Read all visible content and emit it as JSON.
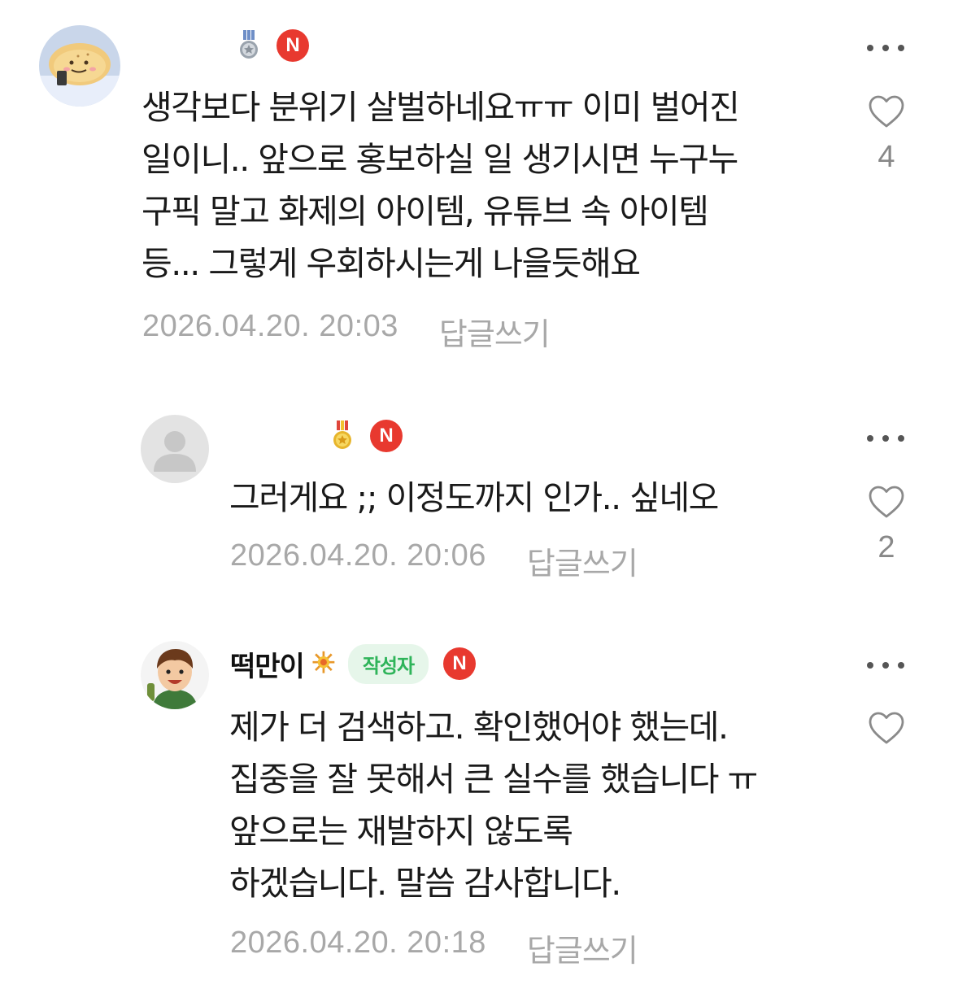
{
  "comments": [
    {
      "author": "",
      "badge": "N",
      "text": "생각보다 분위기 살벌하네요ㅠㅠ 이미 벌어진\n일이니.. 앞으로 홍보하실 일 생기시면 누구누\n구픽 말고 화제의 아이템, 유튜브 속 아이템\n등... 그렇게 우회하시는게 나을듯해요",
      "date": "2026.04.20. 20:03",
      "reply_label": "답글쓰기",
      "likes": "4"
    },
    {
      "author": "",
      "badge": "N",
      "text": "그러게요 ;; 이정도까지 인가.. 싶네오",
      "date": "2026.04.20. 20:06",
      "reply_label": "답글쓰기",
      "likes": "2"
    },
    {
      "author": "떡만이",
      "writer_label": "작성자",
      "badge": "N",
      "text": "제가 더 검색하고. 확인했어야 했는데.\n집중을 잘 못해서 큰 실수를 했습니다 ㅠ\n앞으로는 재발하지 않도록\n하겠습니다. 말씀 감사합니다.",
      "date": "2026.04.20. 20:18",
      "reply_label": "답글쓰기",
      "likes": ""
    }
  ],
  "colors": {
    "new_badge": "#e8392f",
    "writer_badge_bg": "#e6f6ea",
    "writer_badge_text": "#2fb45a",
    "meta_text": "#a8a8a8"
  },
  "icons": [
    "more-icon",
    "heart-icon",
    "medal-icon",
    "new-badge"
  ]
}
